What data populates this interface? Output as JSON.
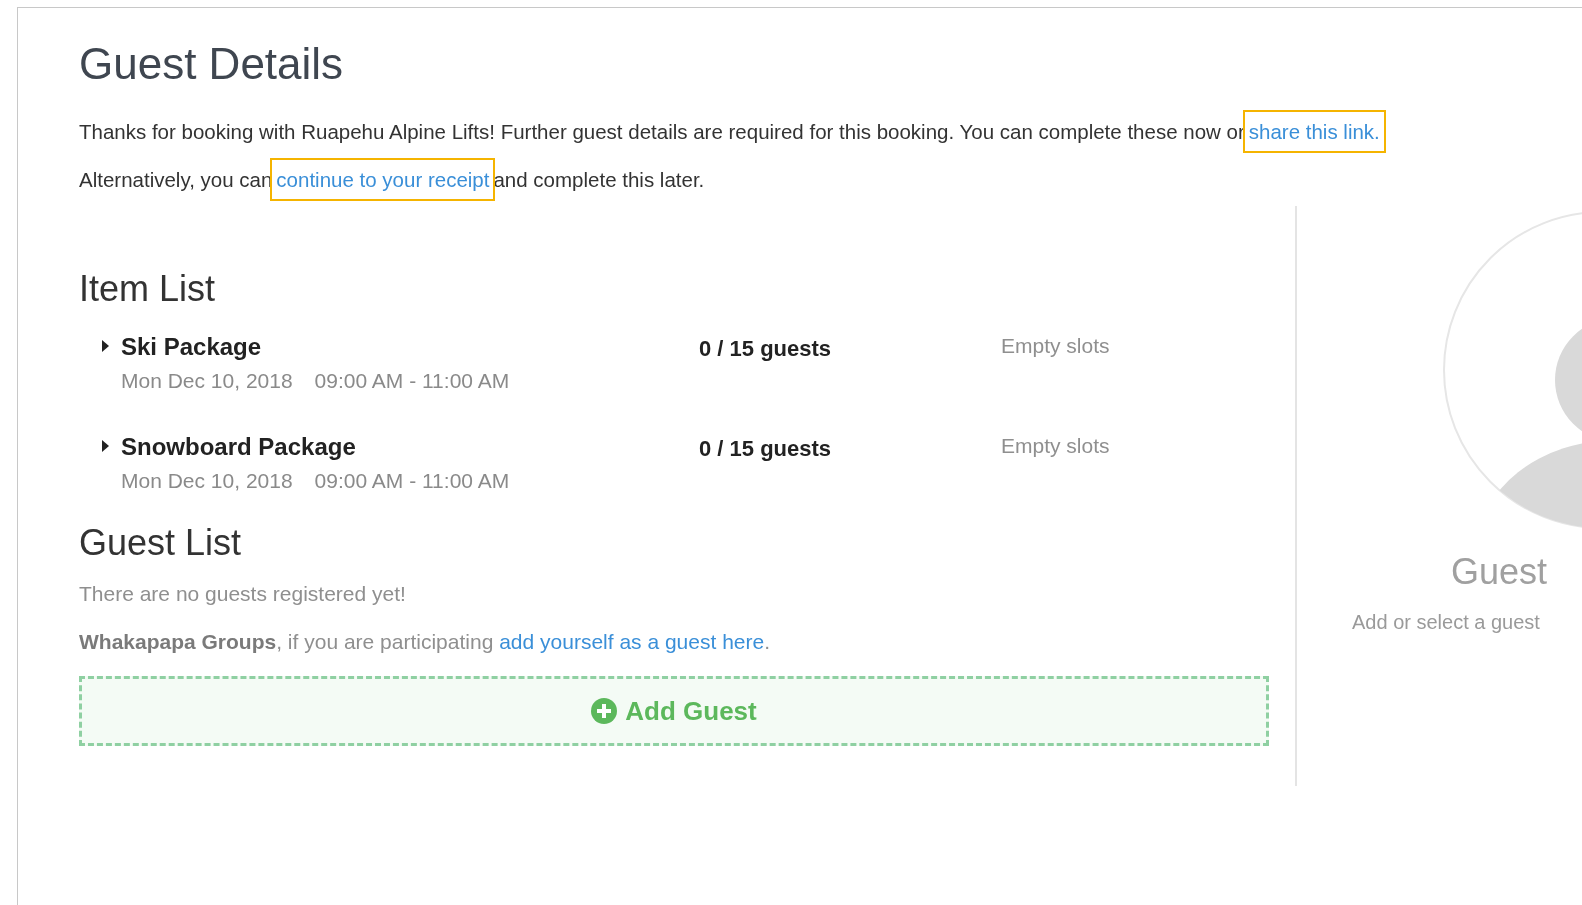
{
  "title": "Guest Details",
  "intro": [
    [
      {
        "kind": "text",
        "text": "Thanks for booking with Ruapehu Alpine Lifts! Further guest details are required for this booking. You can complete these now or"
      },
      {
        "kind": "link",
        "text": "share this link.",
        "highlighted": true
      }
    ],
    [
      {
        "kind": "text",
        "text": "Alternatively, you can"
      },
      {
        "kind": "link",
        "text": "continue to your receipt",
        "highlighted": true
      },
      {
        "kind": "text",
        "text": "and complete this later."
      }
    ]
  ],
  "item_list": {
    "heading": "Item List",
    "items": [
      {
        "name": "Ski Package",
        "expanded": false,
        "date": "Mon Dec 10, 2018",
        "time": "09:00 AM - 11:00 AM",
        "guests": "0 / 15 guests",
        "status": "Empty slots"
      },
      {
        "name": "Snowboard Package",
        "expanded": false,
        "date": "Mon Dec 10, 2018",
        "time": "09:00 AM - 11:00 AM",
        "guests": "0 / 15 guests",
        "status": "Empty slots"
      }
    ]
  },
  "guest_list": {
    "heading": "Guest List",
    "empty_message": "There are no guests registered yet!",
    "group_note": "**Whakapapa Groups**, if you are participating",
    "group_link": "add yourself as a guest here",
    "group_note_end": ".",
    "add_button": "Add Guest"
  },
  "guest_panel": {
    "heading": "Guest",
    "hint": "Add or select a guest"
  }
}
